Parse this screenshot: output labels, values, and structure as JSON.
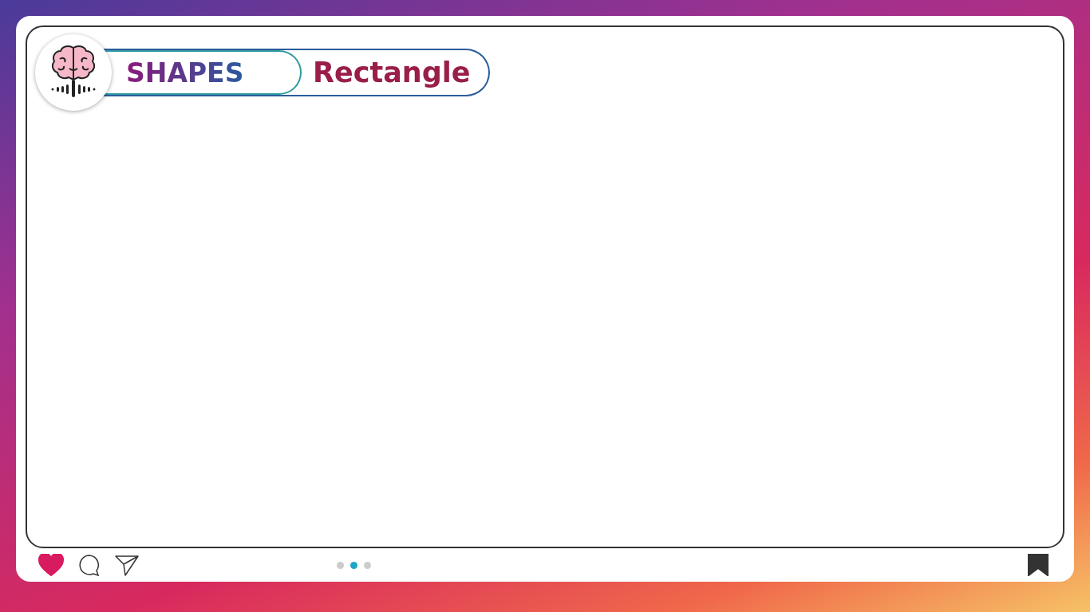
{
  "header": {
    "title": "SHAPES",
    "subtitle": "Rectangle"
  },
  "actions": {
    "liked": true,
    "saved": true
  },
  "pages": [
    {
      "selected": false
    },
    {
      "selected": true
    },
    {
      "selected": false
    }
  ]
}
